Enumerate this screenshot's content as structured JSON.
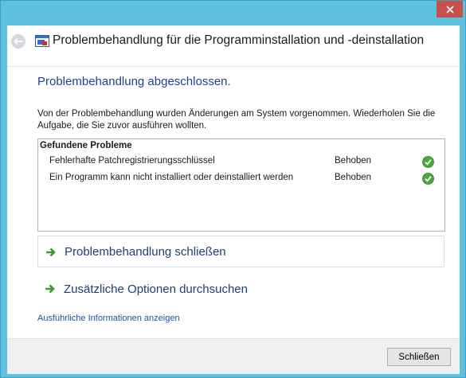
{
  "window": {
    "title": "Problembehandlung für die Programminstallation und -deinstallation",
    "accent_color": "#5fc0e0",
    "close_color": "#c7504b"
  },
  "main": {
    "heading": "Problembehandlung abgeschlossen.",
    "description": "Von der Problembehandlung wurden Änderungen am System vorgenommen. Wiederholen Sie die Aufgabe, die Sie zuvor ausführen wollten.",
    "problems": {
      "title": "Gefundene Probleme",
      "items": [
        {
          "name": "Fehlerhafte Patchregistrierungsschlüssel",
          "status": "Behoben",
          "icon": "check-icon"
        },
        {
          "name": "Ein Programm kann nicht installiert oder deinstalliert werden",
          "status": "Behoben",
          "icon": "check-icon"
        }
      ]
    },
    "actions": [
      {
        "label": "Problembehandlung schließen",
        "icon": "green-arrow-icon"
      },
      {
        "label": "Zusätzliche Optionen durchsuchen",
        "icon": "green-arrow-icon"
      }
    ],
    "details_link": "Ausführliche Informationen anzeigen"
  },
  "footer": {
    "close_button": "Schließen"
  }
}
